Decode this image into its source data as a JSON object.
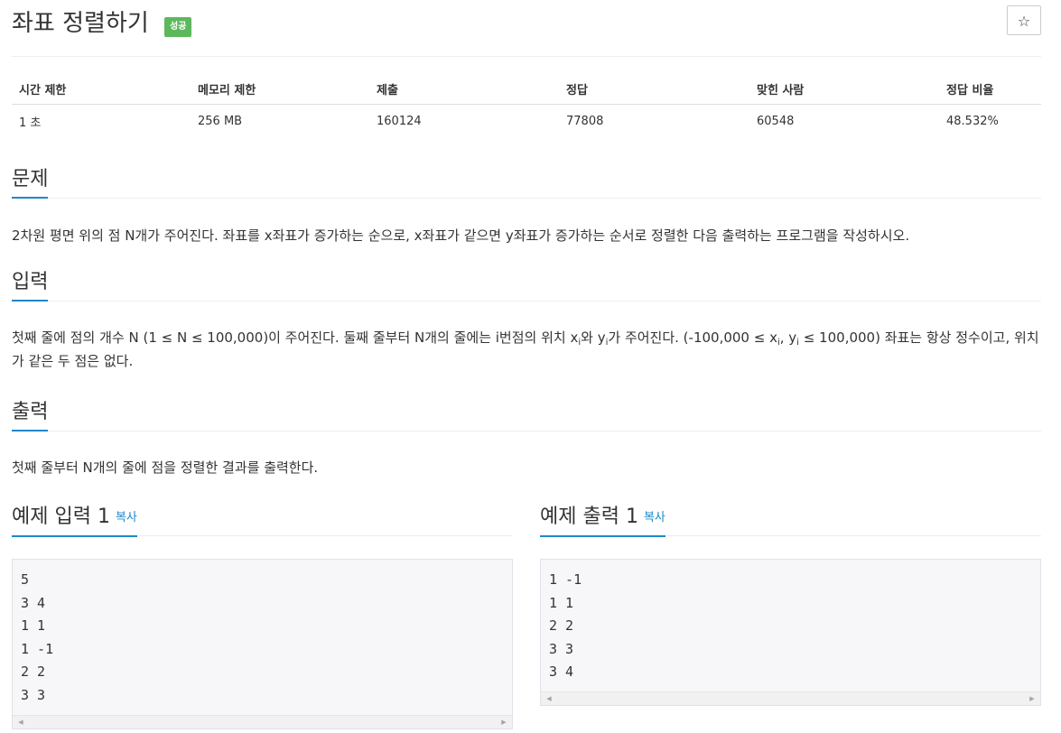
{
  "problem": {
    "title": "좌표 정렬하기",
    "badge": "성공",
    "star_icon": "☆"
  },
  "stats": {
    "headers": [
      "시간 제한",
      "메모리 제한",
      "제출",
      "정답",
      "맞힌 사람",
      "정답 비율"
    ],
    "values": [
      "1 초",
      "256 MB",
      "160124",
      "77808",
      "60548",
      "48.532%"
    ]
  },
  "description": {
    "title": "문제",
    "text": "2차원 평면 위의 점 N개가 주어진다. 좌표를 x좌표가 증가하는 순으로, x좌표가 같으면 y좌표가 증가하는 순서로 정렬한 다음 출력하는 프로그램을 작성하시오."
  },
  "input": {
    "title": "입력",
    "p1": "첫째 줄에 점의 개수 N (1 ≤ N ≤ 100,000)이 주어진다. 둘째 줄부터 N개의 줄에는 i번점의 위치 x",
    "s1": "i",
    "p2": "와 y",
    "s2": "i",
    "p3": "가 주어진다. (-100,000 ≤ x",
    "s3": "i",
    "p4": ", y",
    "s4": "i",
    "p5": " ≤ 100,000) 좌표는 항상 정수이고, 위치가 같은 두 점은 없다."
  },
  "output": {
    "title": "출력",
    "text": "첫째 줄부터 N개의 줄에 점을 정렬한 결과를 출력한다."
  },
  "samples": {
    "input": {
      "title": "예제 입력 1",
      "copy": "복사",
      "content": "5\n3 4\n1 1\n1 -1\n2 2\n3 3"
    },
    "output": {
      "title": "예제 출력 1",
      "copy": "복사",
      "content": "1 -1\n1 1\n2 2\n3 3\n3 4"
    },
    "scroll_left": "◀",
    "scroll_right": "▶"
  }
}
